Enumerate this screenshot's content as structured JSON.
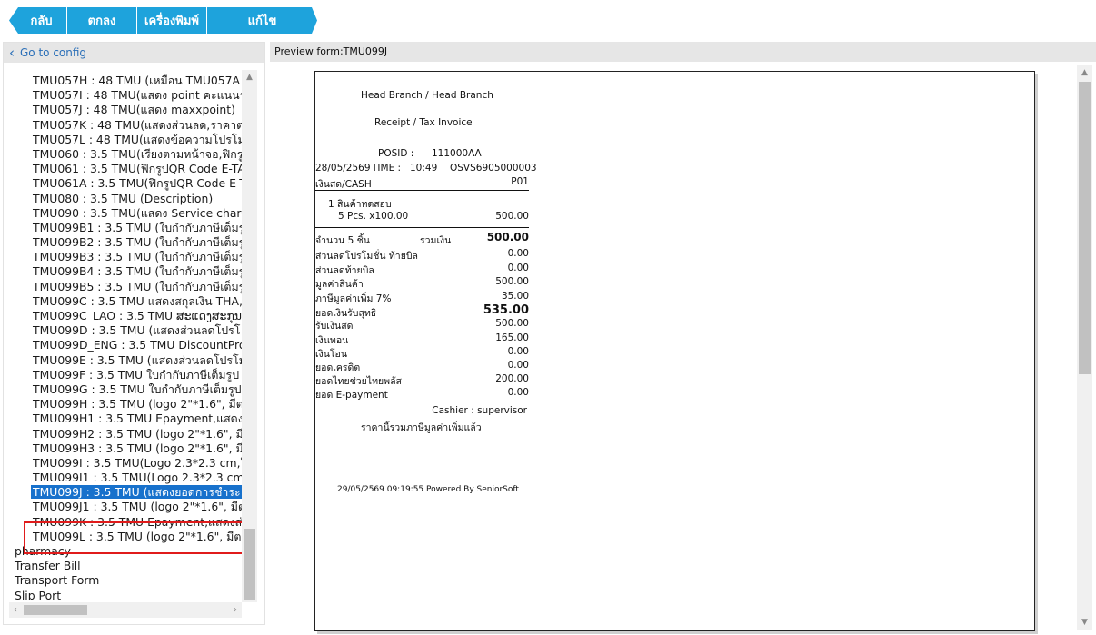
{
  "toolbar": {
    "back": "กลับ",
    "ok": "ตกลง",
    "print": "เครื่องพิมพ์",
    "edit": "แก้ไข"
  },
  "left_panel": {
    "header": "Go to config",
    "items": [
      "TMU057H : 48 TMU (เหมือน TMU057A",
      "TMU057I : 48 TMU(แสดง point คะแนนร",
      "TMU057J : 48 TMU(แสดง maxxpoint)",
      "TMU057K : 48 TMU(แสดงส่วนลด,ราคาต",
      "TMU057L : 48 TMU(แสดงข้อความโปรโม",
      "TMU060 : 3.5 TMU(เรียงตามหน้าจอ,ฟิกรู",
      "TMU061 : 3.5 TMU(ฟิกรูปQR Code E-TA",
      "TMU061A : 3.5 TMU(ฟิกรูปQR Code E-T",
      "TMU080 : 3.5 TMU (Description)",
      "TMU090 : 3.5 TMU(แสดง Service charg",
      "TMU099B1 : 3.5 TMU (ใบกำกับภาษีเต็มรู",
      "TMU099B2 : 3.5 TMU (ใบกำกับภาษีเต็มรู",
      "TMU099B3 : 3.5 TMU (ใบกำกับภาษีเต็มรู",
      "TMU099B4 : 3.5 TMU (ใบกำกับภาษีเต็มรู",
      "TMU099B5 : 3.5 TMU (ใบกำกับภาษีเต็มรู",
      "TMU099C : 3.5 TMU แสดงสกุลเงิน THA,",
      "TMU099C_LAO : 3.5 TMU ສະແດງສະກຸນເງ",
      "TMU099D : 3.5 TMU (แสดงส่วนลดโปรโ",
      "TMU099D_ENG : 3.5 TMU DiscountPro",
      "TMU099E : 3.5 TMU (แสดงส่วนลดโปรโม",
      "TMU099F : 3.5 TMU ใบกำกับภาษีเต็มรูป",
      "TMU099G : 3.5 TMU ใบกำกับภาษีเต็มรูป",
      "TMU099H : 3.5 TMU (logo 2\"*1.6\", มีต",
      "TMU099H1 : 3.5 TMU Epayment,แสดงส",
      "TMU099H2 : 3.5 TMU (logo 2\"*1.6\", มีต",
      "TMU099H3 : 3.5 TMU (logo 2\"*1.6\", มีต",
      "TMU099I : 3.5 TMU(Logo 2.3*2.3 cm,ใ",
      "TMU099I1 : 3.5 TMU(Logo 2.3*2.3 cm",
      "TMU099J : 3.5 TMU (แสดงยอดการชำระ",
      "TMU099J1 : 3.5 TMU (logo 2\"*1.6\", มีต",
      "TMU099K : 3.5 TMU Epayment,แสดงส่",
      "TMU099L : 3.5 TMU (logo 2\"*1.6\", มีต"
    ],
    "top_items": [
      "pharmacy",
      "Transfer Bill",
      "Transport Form",
      "Slip Port"
    ]
  },
  "preview": {
    "header": "Preview form:TMU099J"
  },
  "receipt": {
    "branch": "Head Branch / Head Branch",
    "title": "Receipt / Tax Invoice",
    "posid_label": "POSID :",
    "posid": "111000AA",
    "date": "28/05/2569",
    "time_label": "TIME :",
    "time": "10:49",
    "doc_no": "OSVS6905000003",
    "payment_type": "เงินสด/CASH",
    "pos_code": "P01",
    "item_line": "1  สินค้าทดสอบ",
    "item_qty": "5 Pcs.  x100.00",
    "item_total": "500.00",
    "qty_label": "จำนวน 5 ชิ้น",
    "sum_label": "รวมเงิน",
    "sum_value": "500.00",
    "summary": [
      {
        "label": "ส่วนลดโปรโมชั่น ท้ายบิล",
        "value": "0.00"
      },
      {
        "label": "ส่วนลดท้ายบิล",
        "value": "0.00"
      },
      {
        "label": "มูลค่าสินค้า",
        "value": "500.00"
      },
      {
        "label": "ภาษีมูลค่าเพิ่ม 7%",
        "value": "35.00"
      }
    ],
    "net_label": "ยอดเงินรับสุทธิ",
    "net_value": "535.00",
    "payments": [
      {
        "label": "รับเงินสด",
        "value": "500.00"
      },
      {
        "label": "เงินทอน",
        "value": "165.00"
      },
      {
        "label": "เงินโอน",
        "value": "0.00"
      },
      {
        "label": "ยอดเครดิต",
        "value": "0.00"
      },
      {
        "label": "ยอดไทยช่วยไทยพลัส",
        "value": "200.00"
      },
      {
        "label": "ยอด E-payment",
        "value": "0.00"
      }
    ],
    "cashier": "Cashier : supervisor",
    "vat_note": "ราคานี้รวมภาษีมูลค่าเพิ่มแล้ว",
    "footer": "29/05/2569 09:19:55 Powered By SeniorSoft"
  }
}
